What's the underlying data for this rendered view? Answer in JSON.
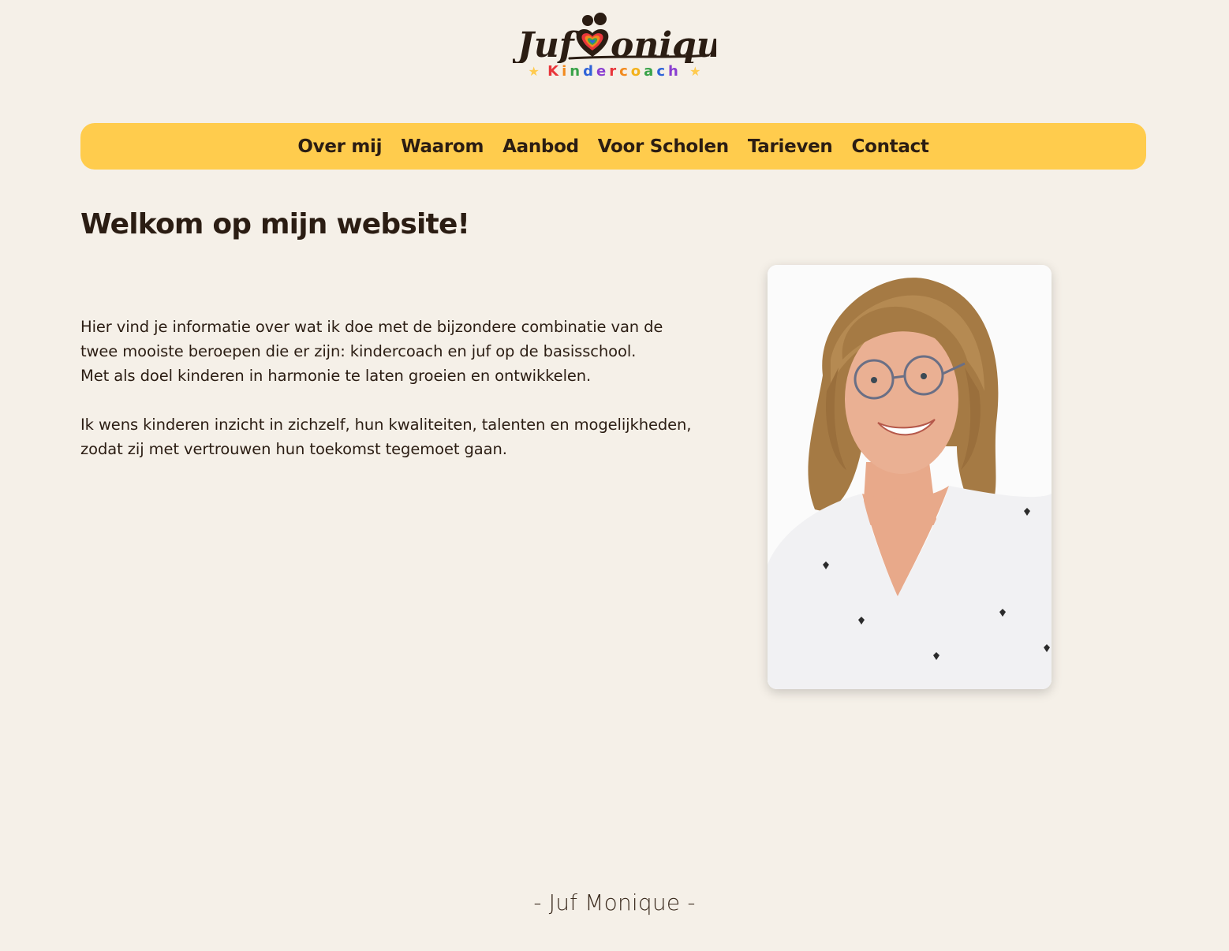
{
  "logo": {
    "title": "Juf Monique",
    "subtitle": "Kindercoach",
    "subtitle_letters": [
      {
        "ch": "K",
        "color": "#e8363b"
      },
      {
        "ch": "i",
        "color": "#f28a1e"
      },
      {
        "ch": "n",
        "color": "#3aa34a"
      },
      {
        "ch": "d",
        "color": "#2f63d8"
      },
      {
        "ch": "e",
        "color": "#8a3fd1"
      },
      {
        "ch": "r",
        "color": "#e8363b"
      },
      {
        "ch": "c",
        "color": "#f28a1e"
      },
      {
        "ch": "o",
        "color": "#f3b21d"
      },
      {
        "ch": "a",
        "color": "#3aa34a"
      },
      {
        "ch": "c",
        "color": "#2f63d8"
      },
      {
        "ch": "h",
        "color": "#8a3fd1"
      }
    ]
  },
  "nav": {
    "items": [
      {
        "label": "Over mij"
      },
      {
        "label": "Waarom"
      },
      {
        "label": "Aanbod"
      },
      {
        "label": "Voor Scholen"
      },
      {
        "label": "Tarieven"
      },
      {
        "label": "Contact"
      }
    ]
  },
  "main": {
    "title": "Welkom op mijn website!",
    "paragraph1": "Hier vind je informatie over wat ik doe met de bijzondere combinatie van de twee mooiste beroepen die er zijn: kindercoach en juf op de basisschool.",
    "paragraph2": "Met als doel kinderen in harmonie te laten groeien en ontwikkelen.",
    "paragraph3": "Ik wens kinderen inzicht in zichzelf, hun kwaliteiten, talenten en mogelijkheden, zodat zij met vertrouwen hun toekomst tegemoet gaan."
  },
  "footer": {
    "text": "- Juf Monique -"
  },
  "colors": {
    "background": "#f5f0e8",
    "nav": "#ffcc4d",
    "text": "#2b1d13"
  }
}
